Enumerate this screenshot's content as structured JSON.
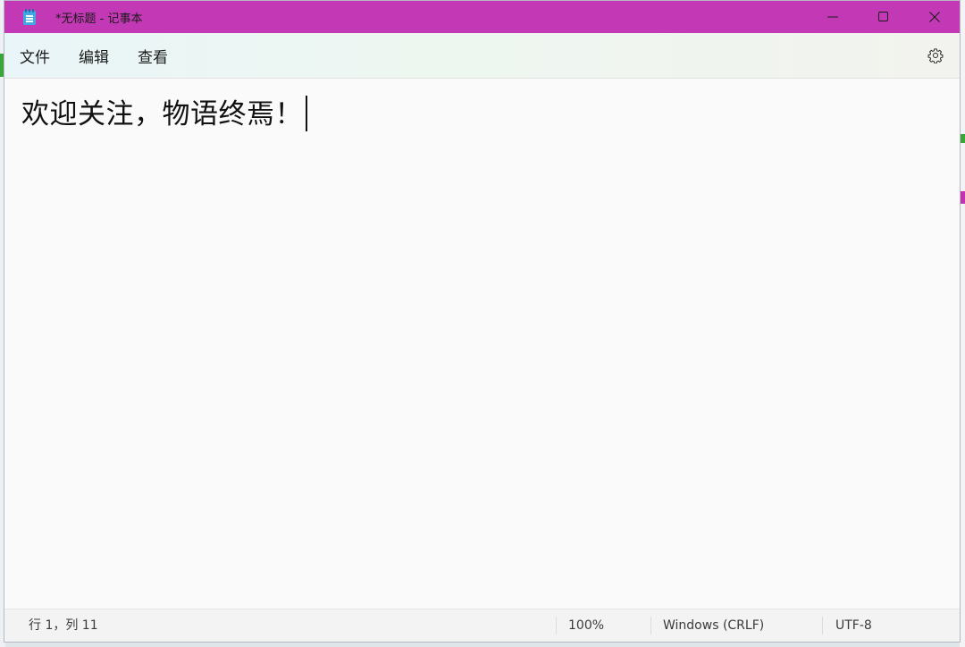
{
  "window": {
    "title": "*无标题 - 记事本",
    "titlebar_color": "#c338b5"
  },
  "menu": {
    "items": [
      "文件",
      "编辑",
      "查看"
    ]
  },
  "editor": {
    "content": "欢迎关注，物语终焉！"
  },
  "status": {
    "position": "行 1，列 11",
    "zoom": "100%",
    "line_ending": "Windows (CRLF)",
    "encoding": "UTF-8"
  }
}
